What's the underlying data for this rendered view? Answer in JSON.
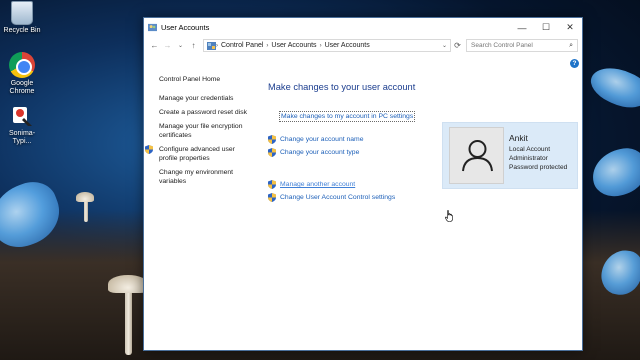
{
  "desktop": {
    "icons": [
      {
        "label": "Recycle Bin",
        "icon": "recycle-bin-icon"
      },
      {
        "label": "Google Chrome",
        "icon": "chrome-icon"
      },
      {
        "label": "Sonima-Typi...",
        "icon": "sonima-app-icon"
      }
    ]
  },
  "window": {
    "title": "User Accounts",
    "controls": {
      "minimize": "—",
      "maximize": "☐",
      "close": "✕"
    }
  },
  "address": {
    "back": "←",
    "forward": "→",
    "recent": "⌄",
    "up": "↑",
    "crumbs": [
      "Control Panel",
      "User Accounts",
      "User Accounts"
    ],
    "refresh": "⟳",
    "search_placeholder": "Search Control Panel"
  },
  "help_label": "?",
  "leftnav": {
    "home": "Control Panel Home",
    "items": [
      {
        "label": "Manage your credentials",
        "shield": false
      },
      {
        "label": "Create a password reset disk",
        "shield": false
      },
      {
        "label": "Manage your file encryption certificates",
        "shield": false
      },
      {
        "label": "Configure advanced user profile properties",
        "shield": true
      },
      {
        "label": "Change my environment variables",
        "shield": false
      }
    ]
  },
  "main": {
    "heading": "Make changes to your user account",
    "pc_settings_link": "Make changes to my account in PC settings",
    "tasks": [
      {
        "label": "Change your account name"
      },
      {
        "label": "Change your account type"
      }
    ],
    "tasks2": [
      {
        "label": "Manage another account",
        "hover": true
      },
      {
        "label": "Change User Account Control settings"
      }
    ]
  },
  "account": {
    "name": "Ankit",
    "details": [
      "Local Account",
      "Administrator",
      "Password protected"
    ]
  },
  "colors": {
    "link": "#1c5fb8",
    "heading": "#1c3e8f",
    "account_panel": "#dbeaf8"
  }
}
